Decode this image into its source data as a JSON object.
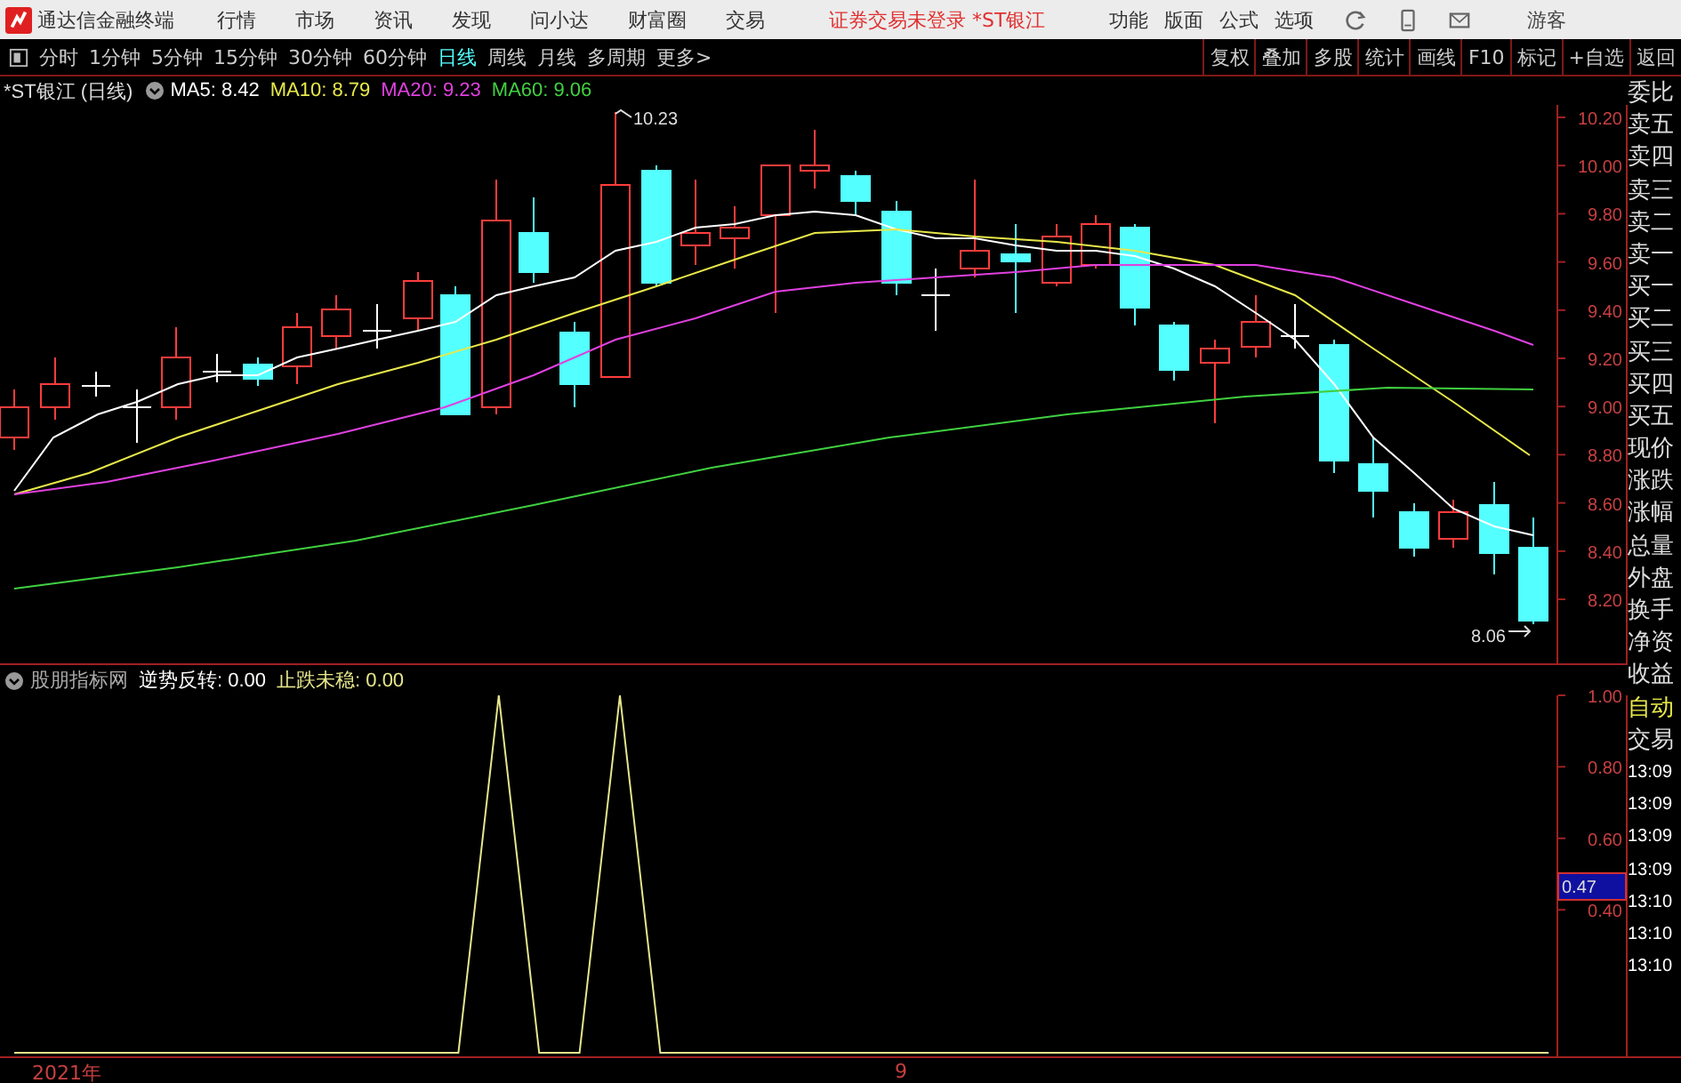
{
  "app": {
    "title": "通达信金融终端"
  },
  "menu": [
    "行情",
    "市场",
    "资讯",
    "发现",
    "问小达",
    "财富圈",
    "交易"
  ],
  "login_status": "证券交易未登录  *ST银江",
  "menu_right": [
    "功能",
    "版面",
    "公式",
    "选项"
  ],
  "user": "游客",
  "periods": [
    {
      "label": "分时",
      "selected": false
    },
    {
      "label": "1分钟",
      "selected": false
    },
    {
      "label": "5分钟",
      "selected": false
    },
    {
      "label": "15分钟",
      "selected": false
    },
    {
      "label": "30分钟",
      "selected": false
    },
    {
      "label": "60分钟",
      "selected": false
    },
    {
      "label": "日线",
      "selected": true
    },
    {
      "label": "周线",
      "selected": false
    },
    {
      "label": "月线",
      "selected": false
    },
    {
      "label": "多周期",
      "selected": false
    },
    {
      "label": "更多>",
      "selected": false
    }
  ],
  "tools": [
    "复权",
    "叠加",
    "多股",
    "统计",
    "画线",
    "F10",
    "标记",
    "+自选",
    "返回"
  ],
  "main_chart": {
    "title": "*ST银江 (日线)",
    "indicators": [
      {
        "label": "MA5: 8.42",
        "color": "#ffffff"
      },
      {
        "label": "MA10: 8.79",
        "color": "#e8e84a"
      },
      {
        "label": "MA20: 9.23",
        "color": "#e040e0"
      },
      {
        "label": "MA60: 9.06",
        "color": "#40d040"
      }
    ],
    "high_label": "10.23",
    "low_label": "8.06",
    "price_ticks": [
      "10.20",
      "10.00",
      "9.80",
      "9.60",
      "9.40",
      "9.20",
      "9.00",
      "8.80",
      "8.60",
      "8.40",
      "8.20"
    ]
  },
  "sub_chart": {
    "title": "股朋指标网",
    "indicators": [
      {
        "label": "逆势反转: 0.00",
        "color": "#ffffff"
      },
      {
        "label": "止跌未稳: 0.00",
        "color": "#e6e68c"
      }
    ],
    "cursor_value": "0.47",
    "chart_data": {
      "type": "line",
      "ylim": [
        0,
        1
      ],
      "yticks": [
        {
          "value": 1,
          "label": "1.00"
        },
        {
          "value": 0.8,
          "label": "0.80"
        },
        {
          "value": 0.6,
          "label": "0.60"
        },
        {
          "value": 0.4,
          "label": "0.40"
        }
      ],
      "series": [
        {
          "color": "#e6e68c",
          "values": [
            0,
            0,
            0,
            0,
            0,
            0,
            0,
            0,
            0,
            0,
            0,
            0,
            1,
            0,
            0,
            1,
            0,
            0,
            0,
            0,
            0,
            0,
            0,
            0,
            0,
            0,
            0,
            0,
            0,
            0,
            0,
            0,
            0,
            0,
            0,
            0,
            0,
            0,
            0
          ]
        }
      ]
    }
  },
  "quote_panel": [
    {
      "label": "委比",
      "kind": "label"
    },
    {
      "label": "卖五",
      "kind": "label"
    },
    {
      "label": "卖四",
      "kind": "label"
    },
    {
      "label": "卖三",
      "kind": "label"
    },
    {
      "label": "卖二",
      "kind": "label"
    },
    {
      "label": "卖一",
      "kind": "label"
    },
    {
      "label": "买一",
      "kind": "label"
    },
    {
      "label": "买二",
      "kind": "label"
    },
    {
      "label": "买三",
      "kind": "label"
    },
    {
      "label": "买四",
      "kind": "label"
    },
    {
      "label": "买五",
      "kind": "label"
    },
    {
      "label": "现价",
      "kind": "label"
    },
    {
      "label": "涨跌",
      "kind": "label"
    },
    {
      "label": "涨幅",
      "kind": "label"
    },
    {
      "label": "总量",
      "kind": "label"
    },
    {
      "label": "外盘",
      "kind": "label"
    },
    {
      "label": "换手",
      "kind": "label"
    },
    {
      "label": "净资",
      "kind": "label"
    },
    {
      "label": "收益",
      "kind": "label"
    },
    {
      "label": "自动",
      "kind": "highlight"
    },
    {
      "label": "交易",
      "kind": "label"
    },
    {
      "label": "13:09",
      "kind": "time"
    },
    {
      "label": "13:09",
      "kind": "time"
    },
    {
      "label": "13:09",
      "kind": "time"
    },
    {
      "label": "13:09",
      "kind": "time"
    },
    {
      "label": "13:10",
      "kind": "time"
    },
    {
      "label": "13:10",
      "kind": "time"
    },
    {
      "label": "13:10",
      "kind": "time"
    }
  ],
  "time_axis": [
    "2021年",
    "9"
  ]
}
